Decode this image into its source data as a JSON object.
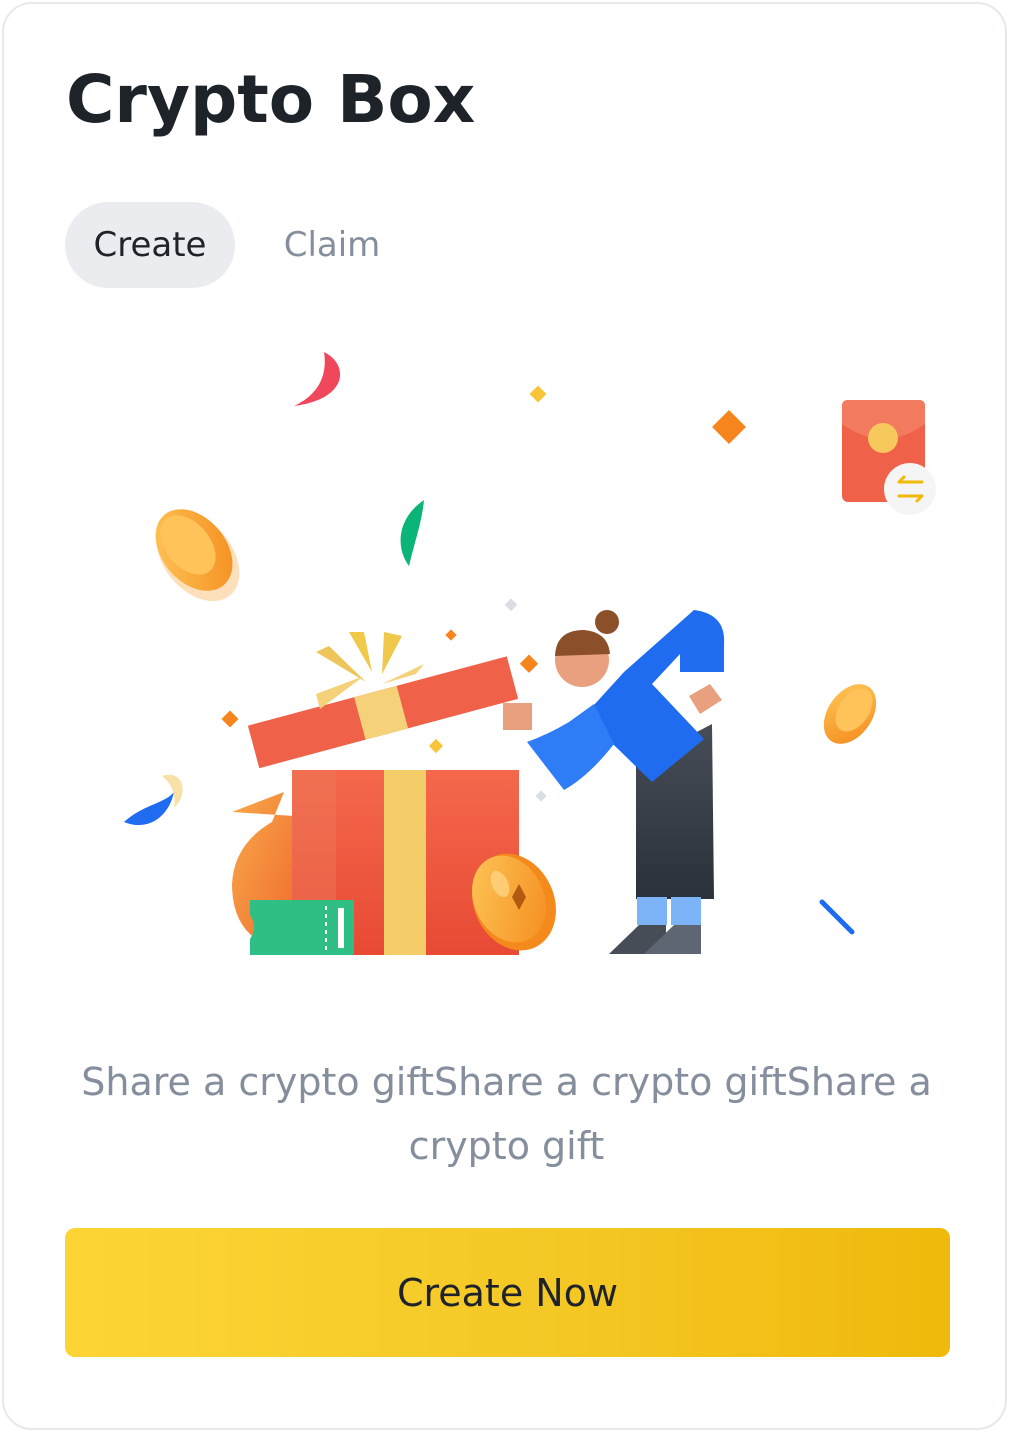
{
  "header": {
    "title": "Crypto Box"
  },
  "tabs": [
    {
      "label": "Create",
      "active": true
    },
    {
      "label": "Claim",
      "active": false
    }
  ],
  "illustration": {
    "icon": "gift-box-illustration",
    "colors": {
      "gift_red": "#f0614a",
      "ribbon_gold": "#f5c85c",
      "coin_orange": "#f7a33b",
      "person_blue": "#1f6cf0",
      "confetti_green": "#0bb577",
      "confetti_pink": "#f0475d"
    }
  },
  "main": {
    "description": "Share a crypto giftShare a crypto giftShare a crypto gift"
  },
  "actions": {
    "create_now_label": "Create Now"
  },
  "colors": {
    "accent": "#fcd535",
    "accent_end": "#f0b90b",
    "text_primary": "#1e2329",
    "text_secondary": "#848e9c",
    "tab_active_bg": "#eaecef"
  }
}
